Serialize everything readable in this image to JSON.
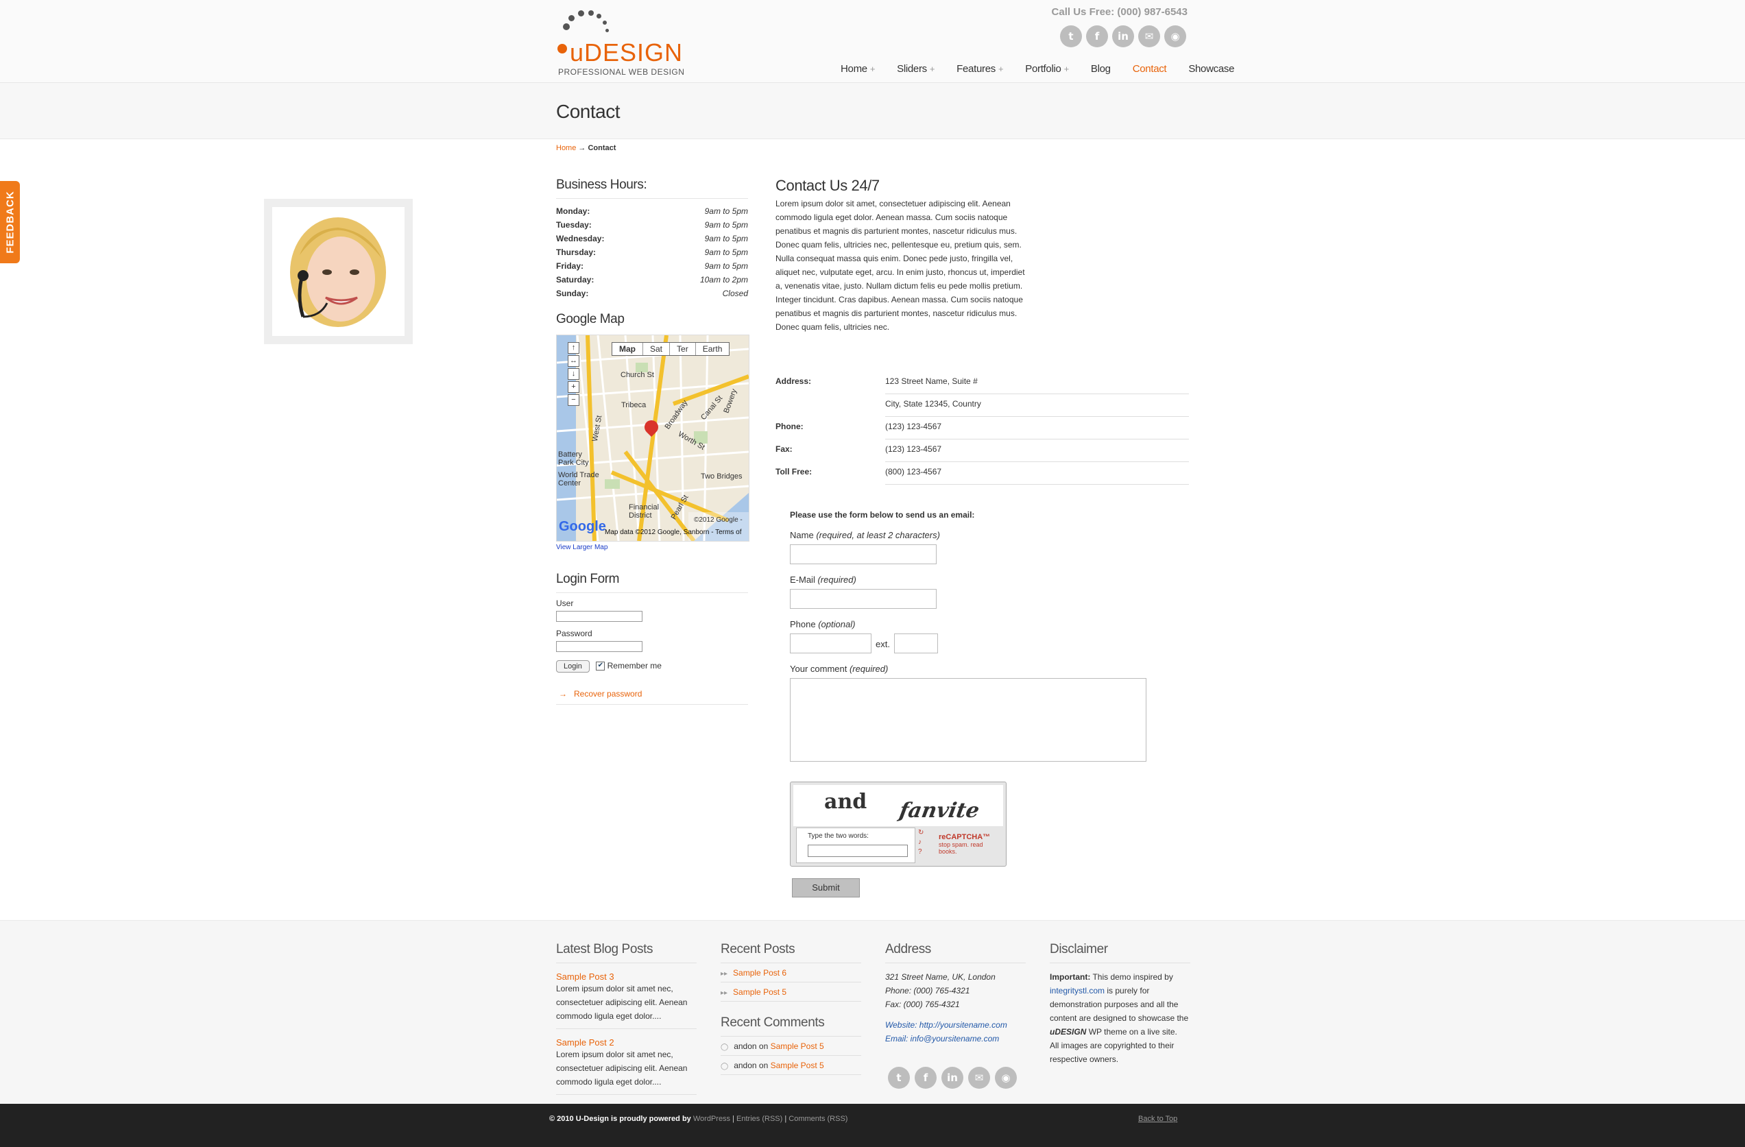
{
  "header": {
    "logo_text": "uDESIGN",
    "logo_sub": "PROFESSIONAL WEB DESIGN",
    "call_us": "Call Us Free: (000) 987-6543",
    "social_icons": [
      "twitter-icon",
      "facebook-icon",
      "linkedin-icon",
      "email-icon",
      "rss-icon"
    ],
    "nav": [
      {
        "label": "Home",
        "has_sub": true
      },
      {
        "label": "Sliders",
        "has_sub": true
      },
      {
        "label": "Features",
        "has_sub": true
      },
      {
        "label": "Portfolio",
        "has_sub": true
      },
      {
        "label": "Blog",
        "has_sub": false
      },
      {
        "label": "Contact",
        "has_sub": false,
        "active": true
      },
      {
        "label": "Showcase",
        "has_sub": false
      }
    ],
    "plus": "+"
  },
  "page": {
    "title": "Contact",
    "breadcrumb_home": "Home",
    "breadcrumb_sep": "→",
    "breadcrumb_current": "Contact"
  },
  "feedback": "FEEDBACK",
  "sidebar": {
    "hours_title": "Business Hours:",
    "hours": [
      {
        "day": "Monday:",
        "time": "9am to 5pm"
      },
      {
        "day": "Tuesday:",
        "time": "9am to 5pm"
      },
      {
        "day": "Wednesday:",
        "time": "9am to 5pm"
      },
      {
        "day": "Thursday:",
        "time": "9am to 5pm"
      },
      {
        "day": "Friday:",
        "time": "9am to 5pm"
      },
      {
        "day": "Saturday:",
        "time": "10am to 2pm"
      },
      {
        "day": "Sunday:",
        "time": "Closed"
      }
    ],
    "map_title": "Google Map",
    "map_tabs": [
      "Map",
      "Sat",
      "Ter",
      "Earth"
    ],
    "map_labels": [
      "Tribeca",
      "Battery Park City",
      "World Trade Center",
      "Two Bridges",
      "Financial District",
      "West St",
      "Church St",
      "Broadway",
      "Worth St",
      "Canal St",
      "Bowery",
      "Pearl St"
    ],
    "map_google": "Google",
    "map_copyright": "©2012 Google -",
    "map_footer": "Map data ©2012 Google, Sanborn - Terms of",
    "view_larger": "View Larger Map",
    "login_title": "Login Form",
    "user_label": "User",
    "password_label": "Password",
    "login_button": "Login",
    "remember_me": "Remember me",
    "recover": "Recover password"
  },
  "main": {
    "heading": "Contact Us 24/7",
    "intro": "Lorem ipsum dolor sit amet, consectetuer adipiscing elit. Aenean commodo ligula eget dolor. Aenean massa. Cum sociis natoque penatibus et magnis dis parturient montes, nascetur ridiculus mus. Donec quam felis, ultricies nec, pellentesque eu, pretium quis, sem. Nulla consequat massa quis enim. Donec pede justo, fringilla vel, aliquet nec, vulputate eget, arcu. In enim justo, rhoncus ut, imperdiet a, venenatis vitae, justo. Nullam dictum felis eu pede mollis pretium. Integer tincidunt. Cras dapibus. Aenean massa. Cum sociis natoque penatibus et magnis dis parturient montes, nascetur ridiculus mus. Donec quam felis, ultricies nec.",
    "contact": [
      {
        "key": "Address:",
        "value": "123 Street Name, Suite #"
      },
      {
        "key": "",
        "value": "City, State 12345, Country"
      },
      {
        "key": "Phone:",
        "value": "(123) 123-4567"
      },
      {
        "key": "Fax:",
        "value": "(123) 123-4567"
      },
      {
        "key": "Toll Free:",
        "value": "(800) 123-4567"
      }
    ]
  },
  "form": {
    "intro": "Please use the form below to send us an email:",
    "name_label": "Name",
    "name_hint": "(required, at least 2 characters)",
    "email_label": "E-Mail",
    "email_hint": "(required)",
    "phone_label": "Phone",
    "phone_hint": "(optional)",
    "ext_label": "ext.",
    "comment_label": "Your comment",
    "comment_hint": "(required)",
    "captcha_word1": "and",
    "captcha_word2": "fanvite",
    "captcha_prompt": "Type the two words:",
    "captcha_brand": "reCAPTCHA™",
    "captcha_tagline": "stop spam. read books.",
    "submit": "Submit"
  },
  "footer": {
    "latest_title": "Latest Blog Posts",
    "latest": [
      {
        "title": "Sample Post 3",
        "excerpt": "Lorem ipsum dolor sit amet nec, consectetuer adipiscing elit. Aenean commodo ligula eget dolor...."
      },
      {
        "title": "Sample Post 2",
        "excerpt": "Lorem ipsum dolor sit amet nec, consectetuer adipiscing elit. Aenean commodo ligula eget dolor...."
      }
    ],
    "recent_title": "Recent Posts",
    "recent": [
      "Sample Post 6",
      "Sample Post 5"
    ],
    "comments_title": "Recent Comments",
    "comments": [
      {
        "author": "andon",
        "on": "on",
        "post": "Sample Post 5"
      },
      {
        "author": "andon",
        "on": "on",
        "post": "Sample Post 5"
      }
    ],
    "address_title": "Address",
    "address_lines": [
      "321 Street Name, UK, London",
      "Phone: (000) 765-4321",
      "Fax: (000) 765-4321"
    ],
    "website": "Website: http://yoursitename.com",
    "email": "Email: info@yoursitename.com",
    "disclaimer_title": "Disclaimer",
    "disclaimer_important": "Important:",
    "disclaimer_text1": "This demo inspired by",
    "disclaimer_link": "integritystl.com",
    "disclaimer_text2": "is purely for demonstration purposes and all the content are designed to showcase the",
    "disclaimer_brand": "uDESIGN",
    "disclaimer_text3": "WP theme on a live site.",
    "disclaimer_text4": "All images are copyrighted to their respective owners."
  },
  "bottombar": {
    "copyright": "© 2010",
    "brand": "U-Design",
    "powered": "is proudly powered by",
    "wordpress": "WordPress",
    "entries": "Entries (RSS)",
    "comments": "Comments (RSS)",
    "back_to_top": "Back to Top"
  },
  "colors": {
    "accent": "#e8630a",
    "footer_bg": "#f6f6f6",
    "bottom_bg": "#222222"
  }
}
